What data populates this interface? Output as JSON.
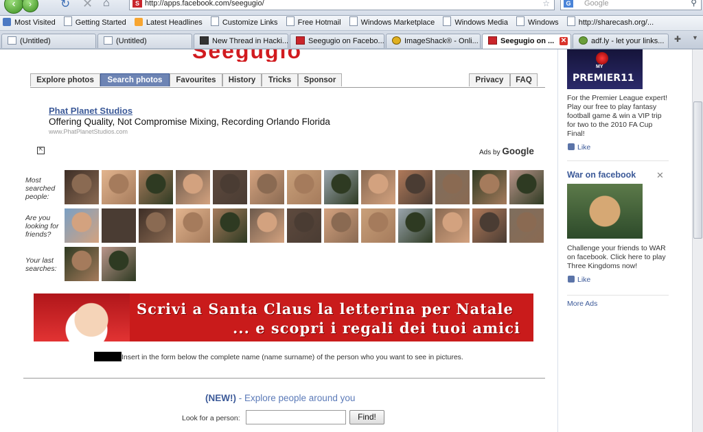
{
  "browser": {
    "back_icon": "back-arrow-icon",
    "forward_icon": "forward-arrow-icon",
    "address_url": "http://apps.facebook.com/seegugio/",
    "search_placeholder": "Google",
    "bookmarks": [
      {
        "label": "Most Visited",
        "icon": "most-visited-icon"
      },
      {
        "label": "Getting Started",
        "icon": "page-icon"
      },
      {
        "label": "Latest Headlines",
        "icon": "rss-icon"
      },
      {
        "label": "Customize Links",
        "icon": "page-icon"
      },
      {
        "label": "Free Hotmail",
        "icon": "page-icon"
      },
      {
        "label": "Windows Marketplace",
        "icon": "page-icon"
      },
      {
        "label": "Windows Media",
        "icon": "page-icon"
      },
      {
        "label": "Windows",
        "icon": "page-icon"
      },
      {
        "label": "http://sharecash.org/...",
        "icon": "page-icon"
      }
    ],
    "tabs": [
      {
        "label": "(Untitled)",
        "active": false
      },
      {
        "label": "(Untitled)",
        "active": false
      },
      {
        "label": "New Thread in Hacki...",
        "active": false
      },
      {
        "label": "Seegugio on Facebo...",
        "active": false
      },
      {
        "label": "ImageShack® - Onli...",
        "active": false
      },
      {
        "label": "Seegugio on ...",
        "active": true
      },
      {
        "label": "adf.ly - let your links...",
        "active": false
      }
    ]
  },
  "app": {
    "logo_text": "Seegugio",
    "nav_tabs": [
      "Explore photos",
      "Search photos",
      "Favourites",
      "History",
      "Tricks",
      "Sponsor"
    ],
    "nav_right": [
      "Privacy",
      "FAQ"
    ],
    "selected_tab": "Search photos",
    "ad": {
      "title": "Phat Planet Studios",
      "description": "Offering Quality, Not Compromise Mixing, Recording Orlando Florida",
      "url": "www.PhatPlanetStudios.com",
      "ads_by": "Ads by",
      "ads_by_brand": "Google"
    },
    "rows": [
      {
        "label": "Most searched people:",
        "count": 13
      },
      {
        "label": "Are you looking for friends?",
        "count": 13
      },
      {
        "label": "Your last searches:",
        "count": 2
      }
    ],
    "banner": {
      "line1": "Scrivi a Santa Claus la letterina per Natale",
      "line2": "... e scopri i regali dei tuoi amici"
    },
    "instructions": "Insert in the form below the complete name (name surname) of the person who you want to see in pictures.",
    "new_badge": "(NEW!)",
    "new_link": " - Explore people around you",
    "look_label": "Look for a person:",
    "find_button": "Find!"
  },
  "sidebar": {
    "premier_brand": "PREMIER",
    "premier_number": "11",
    "premier_my": "MY",
    "premier_text": "For the Premier League expert! Play our free to play fantasy football game & win a VIP trip for two to the 2010 FA Cup Final!",
    "like_label": "Like",
    "war_title": "War on facebook",
    "war_text": "Challenge your friends to WAR on facebook. Click here to play Three Kingdoms now!",
    "more_ads": "More Ads"
  }
}
